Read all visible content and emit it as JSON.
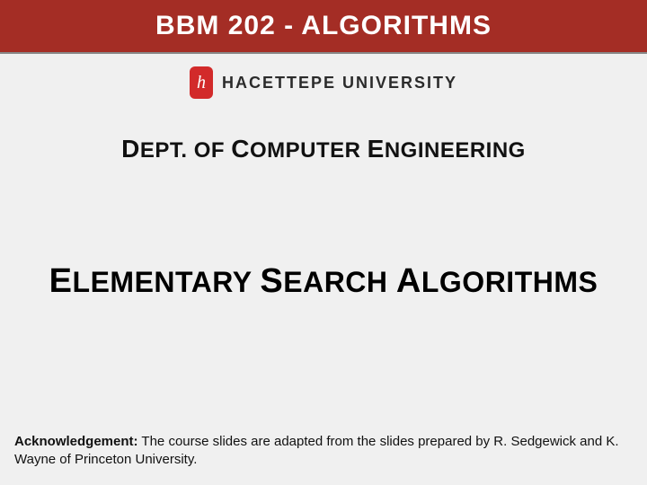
{
  "header": {
    "title": "BBM 202 - ALGORITHMS"
  },
  "university": {
    "logo_glyph": "h",
    "name": "HACETTEPE UNIVERSITY"
  },
  "department": {
    "word1_cap": "D",
    "word1_rest": "EPT.",
    "word2": "OF",
    "word3_cap": "C",
    "word3_rest": "OMPUTER",
    "word4_cap": "E",
    "word4_rest": "NGINEERING"
  },
  "topic": {
    "word1_cap": "E",
    "word1_rest": "LEMENTARY",
    "word2_cap": "S",
    "word2_rest": "EARCH",
    "word3_cap": "A",
    "word3_rest": "LGORITHMS"
  },
  "acknowledgement": {
    "label": "Acknowledgement:",
    "text": " The course slides are adapted from the slides prepared by R. Sedgewick and K. Wayne of Princeton University."
  }
}
